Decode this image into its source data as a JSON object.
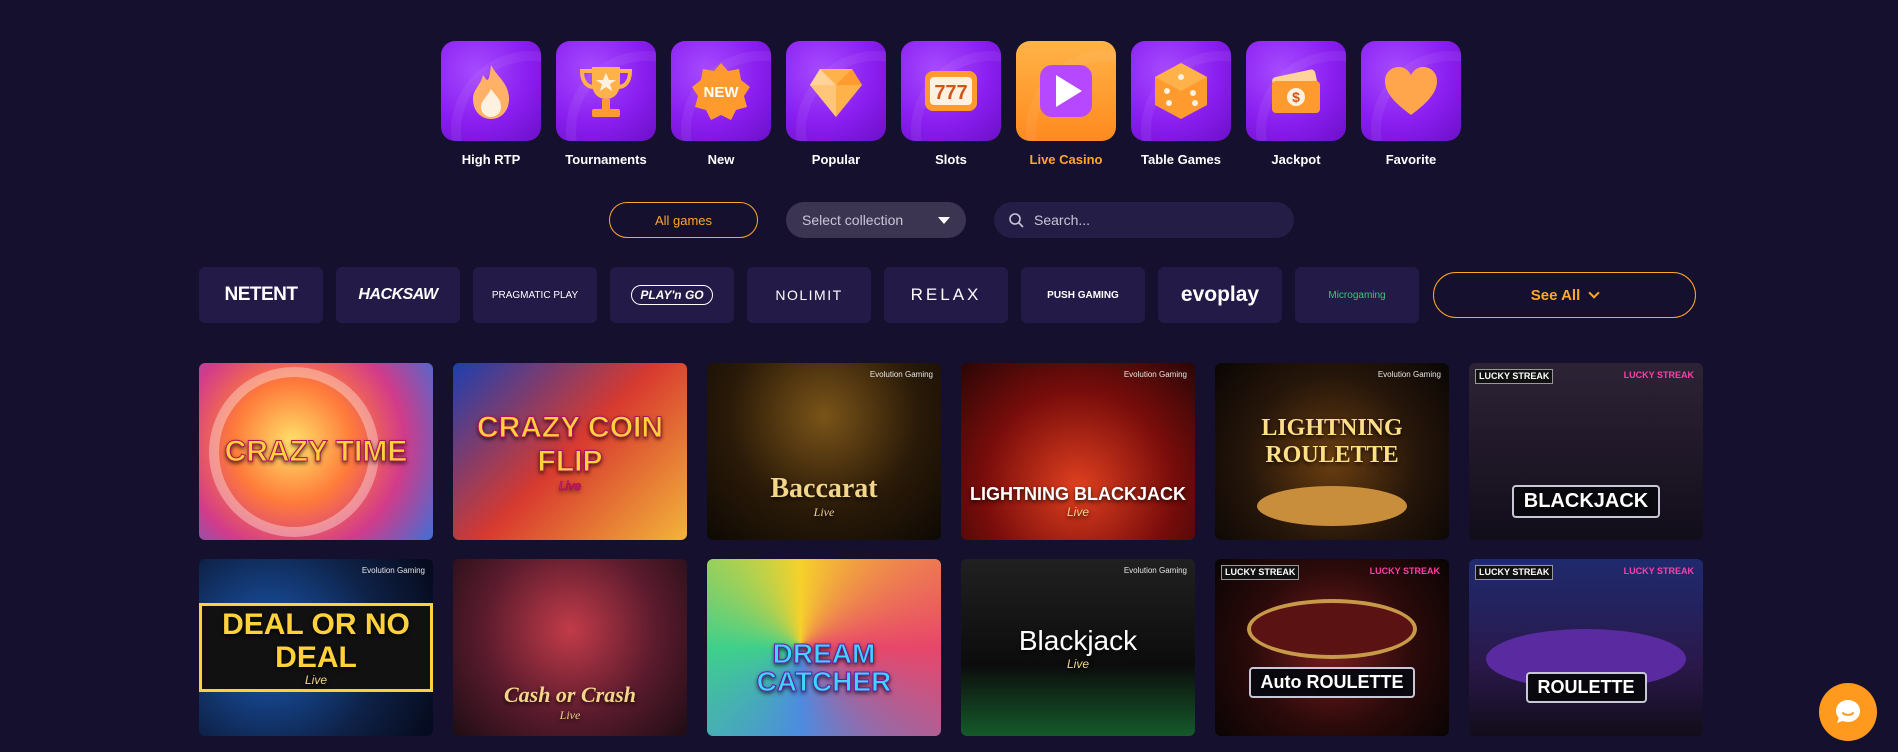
{
  "categories": [
    {
      "label": "High RTP",
      "icon": "flame-icon",
      "active": false
    },
    {
      "label": "Tournaments",
      "icon": "trophy-icon",
      "active": false
    },
    {
      "label": "New",
      "icon": "new-badge-icon",
      "badge_text": "NEW",
      "active": false
    },
    {
      "label": "Popular",
      "icon": "diamond-icon",
      "active": false
    },
    {
      "label": "Slots",
      "icon": "slot-machine-icon",
      "badge_text": "777",
      "active": false
    },
    {
      "label": "Live Casino",
      "icon": "play-icon",
      "active": true
    },
    {
      "label": "Table Games",
      "icon": "dice-icon",
      "active": false
    },
    {
      "label": "Jackpot",
      "icon": "money-icon",
      "badge_text": "$",
      "active": false
    },
    {
      "label": "Favorite",
      "icon": "heart-icon",
      "active": false
    }
  ],
  "filters": {
    "all_games": "All games",
    "collection_placeholder": "Select collection",
    "search_placeholder": "Search..."
  },
  "providers": [
    {
      "name": "NETENT"
    },
    {
      "name": "HACKSAW"
    },
    {
      "name": "PRAGMATIC PLAY"
    },
    {
      "name": "PLAY'n GO"
    },
    {
      "name": "NOLIMIT"
    },
    {
      "name": "RELAX"
    },
    {
      "name": "PUSH GAMING"
    },
    {
      "name": "evoplay"
    },
    {
      "name": "Microgaming"
    }
  ],
  "see_all": "See All",
  "games": [
    {
      "title": "CRAZY TIME",
      "live": false
    },
    {
      "title": "CRAZY COIN FLIP",
      "live": true
    },
    {
      "title": "Baccarat",
      "live": true
    },
    {
      "title": "LIGHTNING BLACKJACK",
      "live": true
    },
    {
      "title": "LIGHTNING ROULETTE",
      "live": false
    },
    {
      "title": "BLACKJACK",
      "live": false,
      "badge_left": "LUCKY STREAK",
      "badge_right": "LUCKY STREAK"
    },
    {
      "title": "DEAL OR NO DEAL",
      "live": true
    },
    {
      "title": "Cash or Crash",
      "live": true
    },
    {
      "title": "DREAM CATCHER",
      "live": false
    },
    {
      "title": "Blackjack",
      "live": true
    },
    {
      "title": "Auto ROULETTE",
      "live": false,
      "badge_left": "LUCKY STREAK",
      "badge_right": "LUCKY STREAK"
    },
    {
      "title": "ROULETTE",
      "live": false,
      "badge_left": "LUCKY STREAK",
      "badge_right": "LUCKY STREAK"
    }
  ],
  "live_label": "Live",
  "evolution_label": "Evolution Gaming",
  "colors": {
    "background": "#15102e",
    "accent": "#ffa826",
    "tile_purple": "#8a1ef0",
    "chat_orange": "#ff9a1f"
  }
}
